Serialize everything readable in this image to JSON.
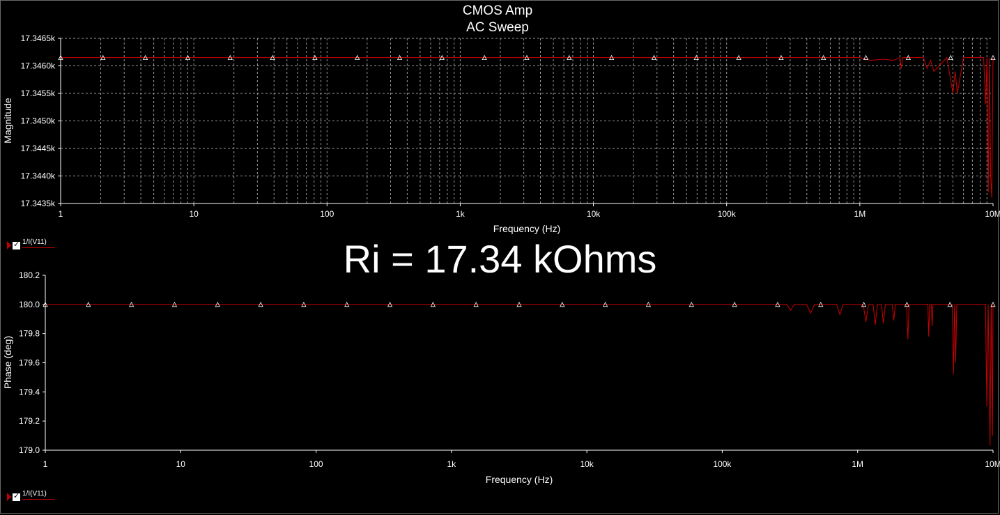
{
  "window": {
    "title_line1": "CMOS Amp",
    "title_line2": "AC Sweep"
  },
  "annotation": "Ri = 17.34 kOhms",
  "legend": {
    "label": "1/I(V11)"
  },
  "colors": {
    "trace": "#cc0000",
    "grid": "#9a9a9a",
    "background": "#000000",
    "text": "#ffffff"
  },
  "chart_data": [
    {
      "type": "line",
      "xscale": "log",
      "xlim": [
        1,
        10000000
      ],
      "xticks": [
        "1",
        "10",
        "100",
        "1k",
        "10k",
        "100k",
        "1M",
        "10M"
      ],
      "xlabel": "Frequency (Hz)",
      "ylabel": "Magnitude",
      "ylim": [
        17343.5,
        17346.5
      ],
      "yticks": [
        "17.3435k",
        "17.3440k",
        "17.3445k",
        "17.3450k",
        "17.3455k",
        "17.3460k",
        "17.3465k"
      ],
      "grid": true,
      "series": [
        {
          "name": "1/I(V11)",
          "x": [
            1,
            1000000,
            1200000,
            1500000,
            1800000,
            2000000,
            2050000,
            2100000,
            3000000,
            3200000,
            3400000,
            3600000,
            4500000,
            5000000,
            5200000,
            5400000,
            6000000,
            8500000,
            8800000,
            9000000,
            9200000,
            9400000,
            9600000,
            9800000,
            10000000
          ],
          "y": [
            17346.15,
            17346.15,
            17346.1,
            17346.12,
            17346.1,
            17346.15,
            17345.95,
            17346.15,
            17346.15,
            17345.95,
            17346.1,
            17345.9,
            17346.15,
            17345.5,
            17345.9,
            17345.5,
            17346.15,
            17346.15,
            17345.3,
            17346.15,
            17343.7,
            17346.15,
            17344.0,
            17343.6,
            17346.15
          ]
        }
      ]
    },
    {
      "type": "line",
      "xscale": "log",
      "xlim": [
        1,
        10000000
      ],
      "xticks": [
        "1",
        "10",
        "100",
        "1k",
        "10k",
        "100k",
        "1M",
        "10M"
      ],
      "xlabel": "Frequency (Hz)",
      "ylabel": "Phase (deg)",
      "ylim": [
        179.0,
        180.2
      ],
      "yticks": [
        "179.0",
        "179.2",
        "179.4",
        "179.6",
        "179.8",
        "180.0",
        "180.2"
      ],
      "grid": false,
      "series": [
        {
          "name": "1/I(V11)",
          "x": [
            1,
            300000,
            320000,
            340000,
            420000,
            450000,
            480000,
            700000,
            740000,
            780000,
            1100000,
            1150000,
            1200000,
            1300000,
            1350000,
            1400000,
            1500000,
            1550000,
            1600000,
            1800000,
            1850000,
            1900000,
            2300000,
            2350000,
            2400000,
            3300000,
            3350000,
            3400000,
            3500000,
            3550000,
            3600000,
            5000000,
            5100000,
            5200000,
            5300000,
            5400000,
            8800000,
            9000000,
            9200000,
            9500000,
            9700000,
            9900000,
            10000000
          ],
          "y": [
            180.0,
            180.0,
            179.96,
            180.0,
            180.0,
            179.94,
            180.0,
            180.0,
            179.93,
            180.0,
            180.0,
            179.88,
            180.0,
            180.0,
            179.86,
            180.0,
            180.0,
            179.87,
            180.0,
            180.0,
            179.89,
            180.0,
            180.0,
            179.76,
            180.0,
            180.0,
            179.78,
            180.0,
            180.0,
            179.85,
            180.0,
            180.0,
            179.52,
            180.0,
            179.6,
            180.0,
            180.0,
            179.3,
            180.0,
            179.03,
            180.0,
            179.1,
            180.0
          ]
        }
      ]
    }
  ]
}
